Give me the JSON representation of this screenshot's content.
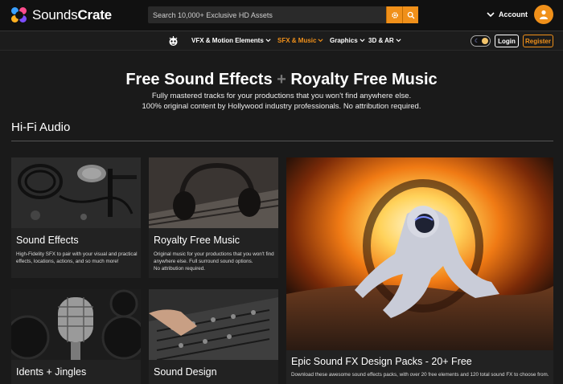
{
  "brand": {
    "name_part1": "Sounds",
    "name_part2": "Crate",
    "logo_icon": "soundscrate-logo"
  },
  "search": {
    "placeholder": "Search 10,000+ Exclusive HD Assets",
    "settings_icon": "gear-icon",
    "search_icon": "search-icon"
  },
  "account": {
    "label": "Account",
    "icon": "user-avatar-icon"
  },
  "nav": {
    "items": [
      {
        "label": "VFX & Motion Elements",
        "active": false
      },
      {
        "label": "SFX & Music",
        "active": true
      },
      {
        "label": "Graphics",
        "active": false
      },
      {
        "label": "3D & AR",
        "active": false
      }
    ],
    "login_label": "Login",
    "register_label": "Register"
  },
  "hero": {
    "title_part1": "Free Sound Effects",
    "plus": "+",
    "title_part2": "Royalty Free Music",
    "subtitle_line1": "Fully mastered tracks for your productions that you won't find anywhere else.",
    "subtitle_line2": "100% original content by Hollywood industry professionals. No attribution required."
  },
  "section": {
    "title": "Hi-Fi Audio"
  },
  "cards": [
    {
      "title": "Sound Effects",
      "desc1": "High-Fidelity SFX to pair with your visual and practical",
      "desc2": "effects, locations, actions, and so much more!",
      "desc3": ""
    },
    {
      "title": "Royalty Free Music",
      "desc1": "Original music for your productions that you won't find",
      "desc2": "anywhere else. Full surround sound options.",
      "desc3": "No attribution required."
    },
    {
      "title": "Epic Sound FX Design Packs - 20+ Free",
      "desc1": "Download these awesome sound effects packs, with over 20 free elements and 120 total sound FX to choose from.",
      "desc2": "",
      "desc3": ""
    },
    {
      "title": "Idents + Jingles",
      "desc1": "",
      "desc2": "",
      "desc3": ""
    },
    {
      "title": "Sound Design",
      "desc1": "",
      "desc2": "",
      "desc3": ""
    }
  ],
  "colors": {
    "accent": "#f0901a",
    "bg": "#1a1a1a",
    "topbar": "#111111"
  }
}
